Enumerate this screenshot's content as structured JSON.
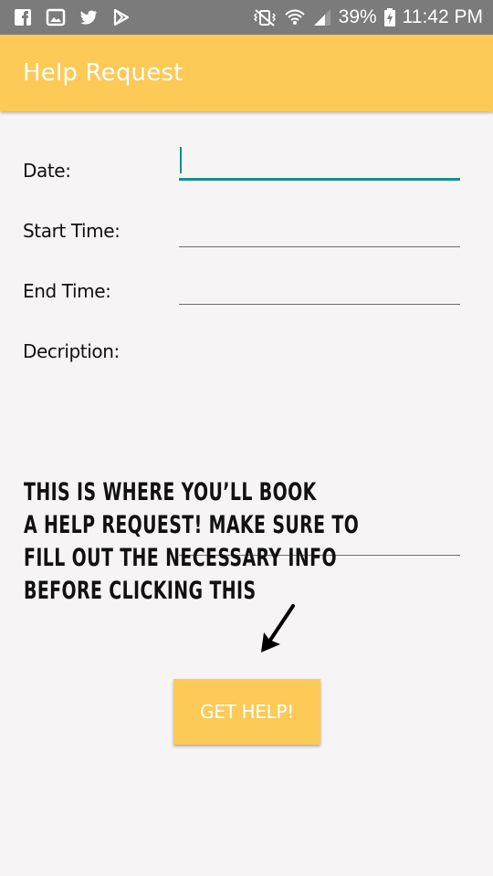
{
  "status_bar": {
    "left_icons": [
      "facebook-icon",
      "gallery-icon",
      "twitter-icon",
      "play-store-icon"
    ],
    "right_icons": [
      "vibrate-mute-icon",
      "wifi-icon",
      "signal-icon",
      "battery-charging-icon"
    ],
    "battery": "39%",
    "time": "11:42 PM"
  },
  "app_bar": {
    "title": "Help Request",
    "color": "#fdc957"
  },
  "form": {
    "date_label": "Date:",
    "date_value": "",
    "start_time_label": "Start Time:",
    "start_time_value": "",
    "end_time_label": "End Time:",
    "end_time_value": "",
    "description_label": "Decription:",
    "description_value": "",
    "accent_color": "#139187"
  },
  "annotation": {
    "lines": [
      "THIS IS WHERE YOU’LL BOOK",
      "A HELP REQUEST! MAKE SURE TO",
      "FILL OUT THE NECESSARY INFO",
      "BEFORE CLICKING THIS"
    ],
    "arrow_icon": "arrow-down-left-icon"
  },
  "button": {
    "label": "GET HELP!",
    "color": "#fdc957"
  }
}
